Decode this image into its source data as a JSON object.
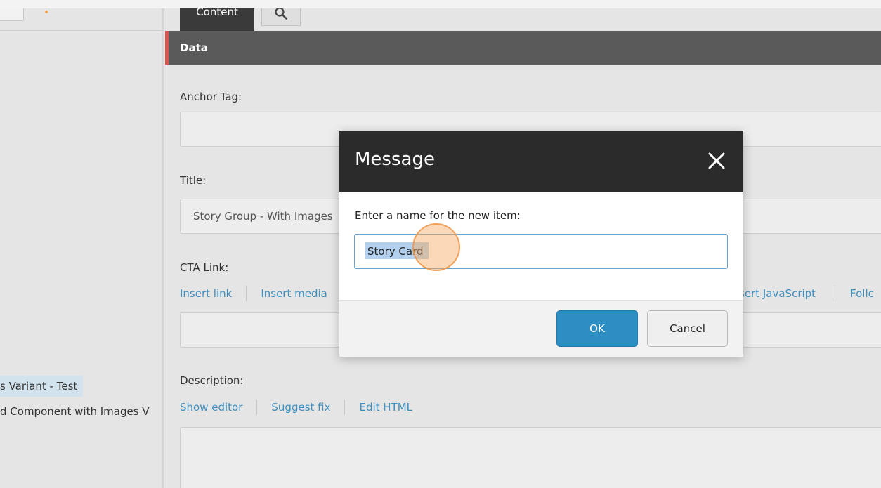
{
  "tabs": {
    "content": "Content",
    "search_icon": "search-icon"
  },
  "section": {
    "title": "Data",
    "accent_color": "#d9534f"
  },
  "fields": {
    "anchor_tag": {
      "label": "Anchor Tag:",
      "value": ""
    },
    "title": {
      "label": "Title:",
      "value": "Story Group - With Images"
    },
    "cta_link": {
      "label": "CTA Link:",
      "links": [
        "Insert link",
        "Insert media"
      ],
      "links_right": [
        "sert JavaScript",
        "Follc"
      ],
      "value": ""
    },
    "description": {
      "label": "Description:",
      "links": [
        "Show editor",
        "Suggest fix",
        "Edit HTML"
      ]
    }
  },
  "tree": {
    "selected_item": "s Variant - Test",
    "item": "d Component with Images V"
  },
  "modal": {
    "title": "Message",
    "prompt": "Enter a name for the new item:",
    "input_value": "Story Card",
    "ok_label": "OK",
    "cancel_label": "Cancel",
    "close_icon": "close-icon"
  },
  "colors": {
    "link": "#3c8fbf",
    "primary_button": "#2d8ec4",
    "modal_header": "#2b2b2b",
    "click_marker": "#f6a860"
  }
}
